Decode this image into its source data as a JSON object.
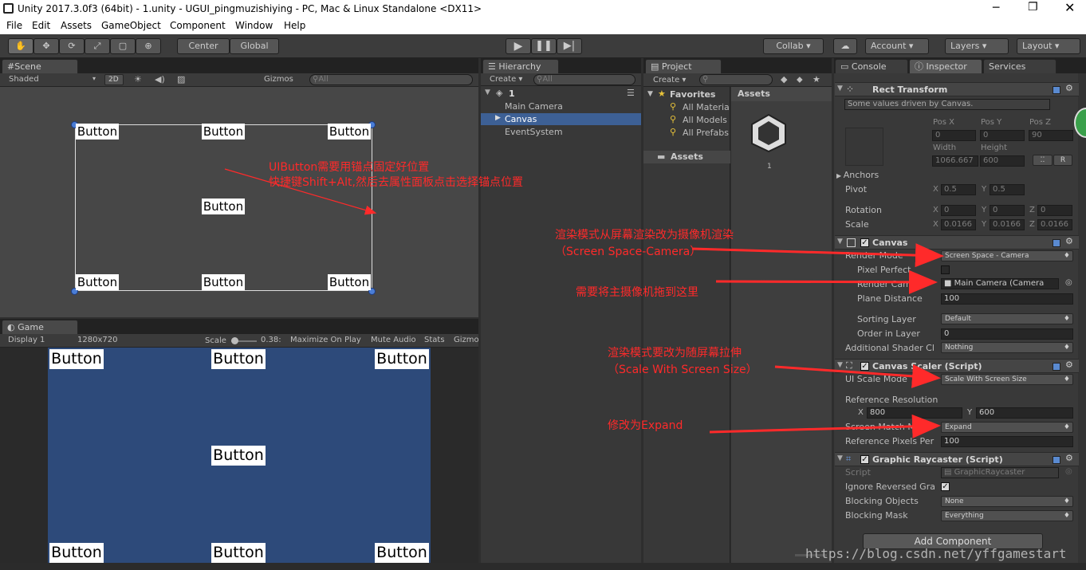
{
  "window": {
    "title": "Unity 2017.3.0f3 (64bit) - 1.unity - UGUI_pingmuzishiying - PC, Mac & Linux Standalone <DX11>",
    "minimize_icon": "minimize-icon",
    "maximize_icon": "restore-icon",
    "close_icon": "close-icon"
  },
  "menu": [
    "File",
    "Edit",
    "Assets",
    "GameObject",
    "Component",
    "Window",
    "Help"
  ],
  "toolbar": {
    "pivot": "Center",
    "space": "Global",
    "collab": "Collab ▾",
    "account": "Account",
    "layers": "Layers",
    "layout": "Layout"
  },
  "scene": {
    "tab": "Scene",
    "shading": "Shaded",
    "mode2d": "2D",
    "gizmos": "Gizmos",
    "search_placeholder": "All",
    "buttons": [
      "Button",
      "Button",
      "Button",
      "Button",
      "Button",
      "Button",
      "Button"
    ]
  },
  "game": {
    "tab": "Game",
    "display": "Display 1",
    "resolution": "1280x720",
    "scale_label": "Scale",
    "scale_value": "0.38:",
    "maximize": "Maximize On Play",
    "mute": "Mute Audio",
    "stats": "Stats",
    "gizmos": "Gizmo",
    "buttons": [
      "Button",
      "Button",
      "Button",
      "Button",
      "Button",
      "Button",
      "Button"
    ]
  },
  "hierarchy": {
    "tab": "Hierarchy",
    "create": "Create",
    "search_placeholder": "All",
    "scene_name": "1",
    "items": [
      "Main Camera",
      "Canvas",
      "EventSystem"
    ]
  },
  "project": {
    "tab": "Project",
    "create": "Create",
    "favorites": "Favorites",
    "fav_items": [
      "All Materia",
      "All Models",
      "All Prefabs"
    ],
    "assets_folder": "Assets",
    "assets_header": "Assets",
    "asset_name": "1"
  },
  "inspector": {
    "tabs": {
      "console": "Console",
      "inspector": "Inspector",
      "services": "Services"
    },
    "rect": {
      "title": "Rect Transform",
      "note": "Some values driven by Canvas.",
      "pos_x_label": "Pos X",
      "pos_y_label": "Pos Y",
      "pos_z_label": "Pos Z",
      "pos_x": "0",
      "pos_y": "0",
      "pos_z": "90",
      "width_label": "Width",
      "height_label": "Height",
      "width": "1066.667",
      "height": "600",
      "r": "R",
      "anchors": "Anchors",
      "pivot": "Pivot",
      "pivot_x": "0.5",
      "pivot_y": "0.5",
      "rotation": "Rotation",
      "rot_x": "0",
      "rot_y": "0",
      "rot_z": "0",
      "scale": "Scale",
      "scale_x": "0.0166",
      "scale_y": "0.0166",
      "scale_z": "0.0166",
      "x": "X",
      "y": "Y",
      "z": "Z"
    },
    "canvas": {
      "title": "Canvas",
      "render_mode_label": "Render Mode",
      "render_mode": "Screen Space - Camera",
      "pixel_perfect": "Pixel Perfect",
      "render_camera_label": "Render Camera",
      "render_camera": "Main Camera (Camera",
      "plane_distance_label": "Plane Distance",
      "plane_distance": "100",
      "sorting_layer_label": "Sorting Layer",
      "sorting_layer": "Default",
      "order_label": "Order in Layer",
      "order": "0",
      "shader_label": "Additional Shader Cl",
      "shader": "Nothing"
    },
    "scaler": {
      "title": "Canvas Scaler (Script)",
      "ui_scale_label": "UI Scale Mode",
      "ui_scale": "Scale With Screen Size",
      "ref_res_label": "Reference Resolution",
      "ref_x": "800",
      "ref_y": "600",
      "match_label": "Screen Match Mode",
      "match": "Expand",
      "ppu_label": "Reference Pixels Per",
      "ppu": "100"
    },
    "raycaster": {
      "title": "Graphic Raycaster (Script)",
      "script_label": "Script",
      "script": "GraphicRaycaster",
      "ignore_label": "Ignore Reversed Gra",
      "blocking_label": "Blocking Objects",
      "blocking": "None",
      "mask_label": "Blocking Mask",
      "mask": "Everything"
    },
    "add_component": "Add Component"
  },
  "annotations": {
    "anchor_line1": "UIButton需要用锚点固定好位置",
    "anchor_line2": "快捷键Shift+Alt,然后去属性面板点击选择锚点位置",
    "render_line1": "渲染模式从屏幕渲染改为摄像机渲染",
    "render_line2": "（Screen Space-Camera）",
    "camera": "需要将主摄像机拖到这里",
    "scale_line1": "渲染模式要改为随屏幕拉伸",
    "scale_line2": "（Scale With Screen Size）",
    "expand": "修改为Expand",
    "color": "#ff2a2a"
  },
  "watermark": "https://blog.csdn.net/yffgamestart",
  "colors": {
    "game_bg": "#2d4a7a",
    "selection": "#3d6095"
  }
}
